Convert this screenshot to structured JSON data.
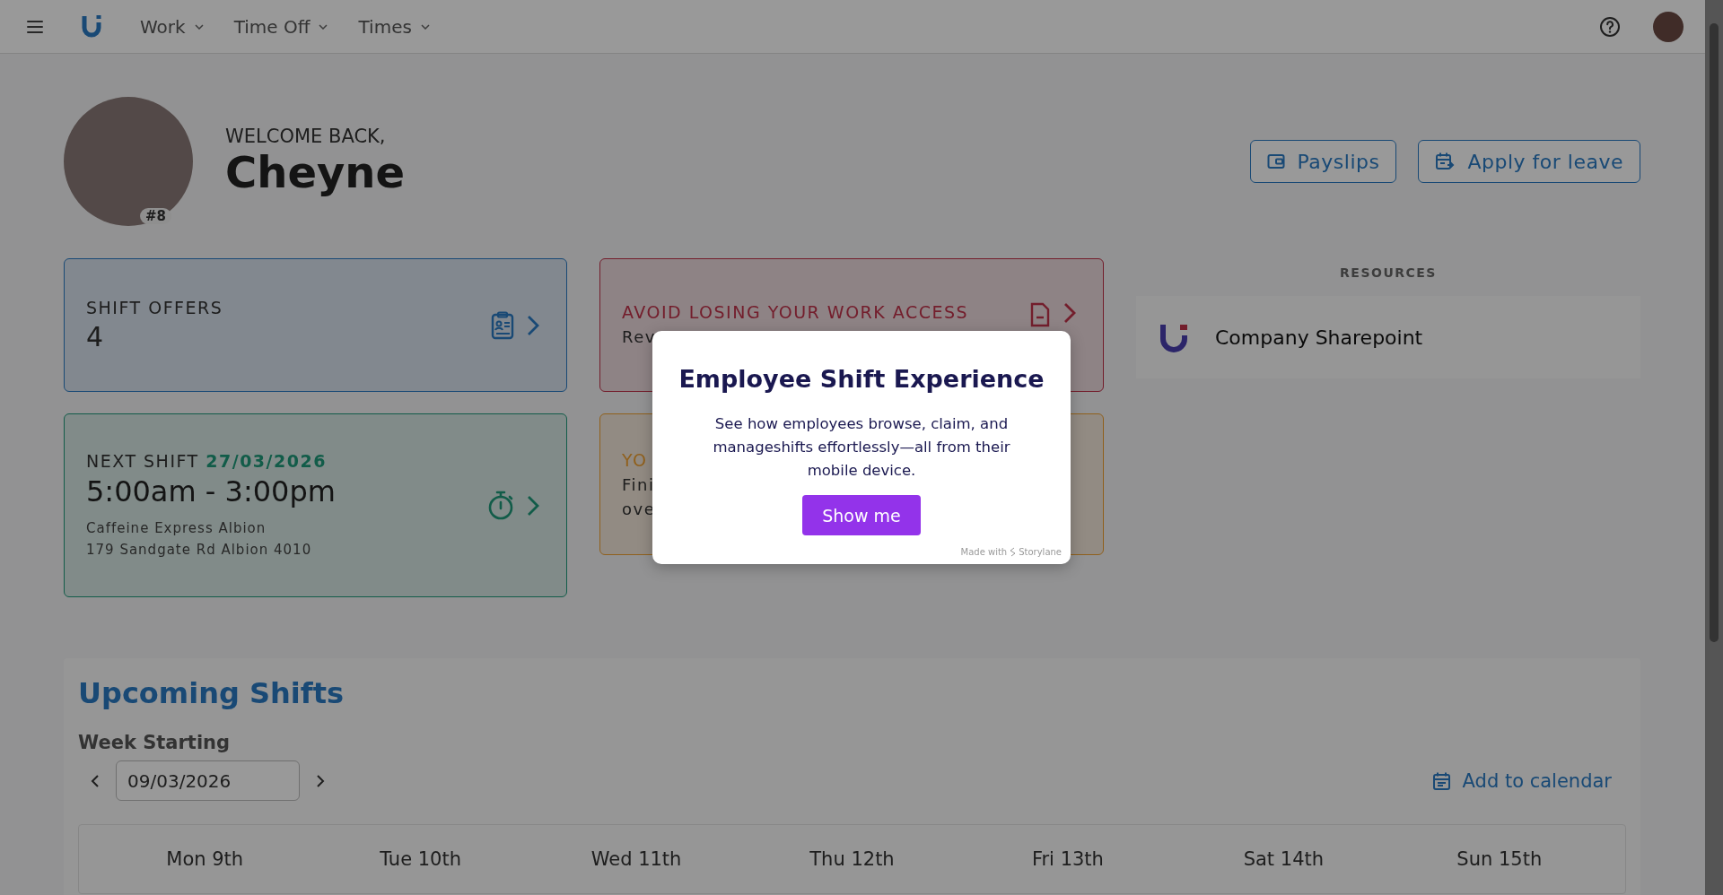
{
  "nav": {
    "items": [
      {
        "label": "Work"
      },
      {
        "label": "Time Off"
      },
      {
        "label": "Times"
      }
    ]
  },
  "welcome": {
    "greeting": "WELCOME BACK,",
    "name": "Cheyne",
    "badge": "#8"
  },
  "actions": [
    {
      "label": "Payslips",
      "kind": "wallet"
    },
    {
      "label": "Apply for leave",
      "kind": "calendar"
    }
  ],
  "cards_left": [
    {
      "kind": "count",
      "title": "SHIFT OFFERS",
      "value": "4"
    },
    {
      "kind": "shift",
      "title": "NEXT SHIFT",
      "date": "27/03/2026",
      "time": "5:00am - 3:00pm",
      "place": "Caffeine Express Albion",
      "address": "179 Sandgate Rd Albion 4010"
    }
  ],
  "cards_middle": [
    {
      "kind": "warning",
      "title": "AVOID LOSING YOUR WORK ACCESS",
      "lines": [
        "Rev"
      ]
    },
    {
      "kind": "reminder",
      "title": "YO",
      "lines": [
        "Fini",
        "ove"
      ]
    }
  ],
  "resources": {
    "heading": "RESOURCES",
    "links": [
      {
        "label": "Company Sharepoint"
      }
    ]
  },
  "upcoming": {
    "title": "Upcoming Shifts",
    "week_label": "Week Starting",
    "date": "09/03/2026",
    "add_label": "Add to calendar",
    "days": [
      "Mon 9th",
      "Tue 10th",
      "Wed 11th",
      "Thu 12th",
      "Fri 13th",
      "Sat 14th",
      "Sun 15th"
    ]
  },
  "modal": {
    "title": "Employee Shift Experience",
    "body": "See how employees browse, claim, and manageshifts effortlessly—all from their mobile device.",
    "button": "Show me",
    "credit": "Made with",
    "brand": "Storylane"
  }
}
